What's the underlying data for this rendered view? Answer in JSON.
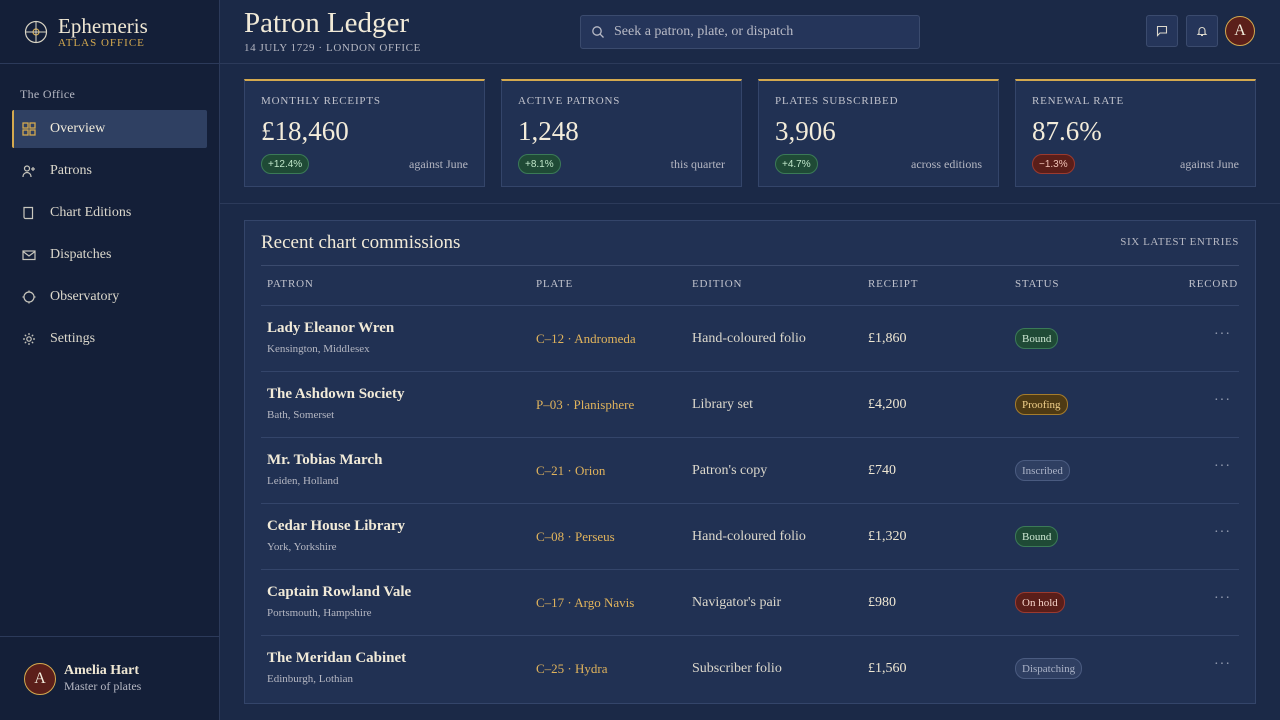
{
  "brand": {
    "name": "Ephemeris",
    "sub": "ATLAS OFFICE"
  },
  "nav": {
    "section": "The Office",
    "items": [
      {
        "label": "Overview",
        "icon": "grid-icon"
      },
      {
        "label": "Patrons",
        "icon": "user-add-icon"
      },
      {
        "label": "Chart Editions",
        "icon": "book-icon"
      },
      {
        "label": "Dispatches",
        "icon": "mail-icon"
      },
      {
        "label": "Observatory",
        "icon": "crosshair-icon"
      },
      {
        "label": "Settings",
        "icon": "gear-icon"
      }
    ]
  },
  "user": {
    "initial": "A",
    "name": "Amelia Hart",
    "role": "Master of plates"
  },
  "header": {
    "title": "Patron Ledger",
    "subtitle": "14 JULY 1729 · LONDON OFFICE",
    "search_placeholder": "Seek a patron, plate, or dispatch",
    "avatar_initial": "A"
  },
  "stats": [
    {
      "label": "MONTHLY RECEIPTS",
      "value": "£18,460",
      "delta": "+12.4%",
      "trend": "up",
      "note": "against June"
    },
    {
      "label": "ACTIVE PATRONS",
      "value": "1,248",
      "delta": "+8.1%",
      "trend": "up",
      "note": "this quarter"
    },
    {
      "label": "PLATES SUBSCRIBED",
      "value": "3,906",
      "delta": "+4.7%",
      "trend": "up",
      "note": "across editions"
    },
    {
      "label": "RENEWAL RATE",
      "value": "87.6%",
      "delta": "−1.3%",
      "trend": "down",
      "note": "against June"
    }
  ],
  "table": {
    "title": "Recent chart commissions",
    "meta": "SIX LATEST ENTRIES",
    "columns": [
      "PATRON",
      "PLATE",
      "EDITION",
      "RECEIPT",
      "STATUS",
      "RECORD"
    ],
    "rows": [
      {
        "name": "Lady Eleanor Wren",
        "location": "Kensington, Middlesex",
        "plate": "C–12 · Andromeda",
        "edition": "Hand-coloured folio",
        "receipt": "£1,860",
        "status": "Bound",
        "status_class": "st-bound"
      },
      {
        "name": "The Ashdown Society",
        "location": "Bath, Somerset",
        "plate": "P–03 · Planisphere",
        "edition": "Library set",
        "receipt": "£4,200",
        "status": "Proofing",
        "status_class": "st-proofing"
      },
      {
        "name": "Mr. Tobias March",
        "location": "Leiden, Holland",
        "plate": "C–21 · Orion",
        "edition": "Patron's copy",
        "receipt": "£740",
        "status": "Inscribed",
        "status_class": "st-inscribed"
      },
      {
        "name": "Cedar House Library",
        "location": "York, Yorkshire",
        "plate": "C–08 · Perseus",
        "edition": "Hand-coloured folio",
        "receipt": "£1,320",
        "status": "Bound",
        "status_class": "st-bound"
      },
      {
        "name": "Captain Rowland Vale",
        "location": "Portsmouth, Hampshire",
        "plate": "C–17 · Argo Navis",
        "edition": "Navigator's pair",
        "receipt": "£980",
        "status": "On hold",
        "status_class": "st-onhold"
      },
      {
        "name": "The Meridan Cabinet",
        "location": "Edinburgh, Lothian",
        "plate": "C–25 · Hydra",
        "edition": "Subscriber folio",
        "receipt": "£1,560",
        "status": "Dispatching",
        "status_class": "st-dispatching"
      }
    ],
    "more_label": "···"
  },
  "colors": {
    "accent": "#d4a94f",
    "background": "#1b2947",
    "sidebar": "#141f38",
    "panel": "#213153"
  }
}
